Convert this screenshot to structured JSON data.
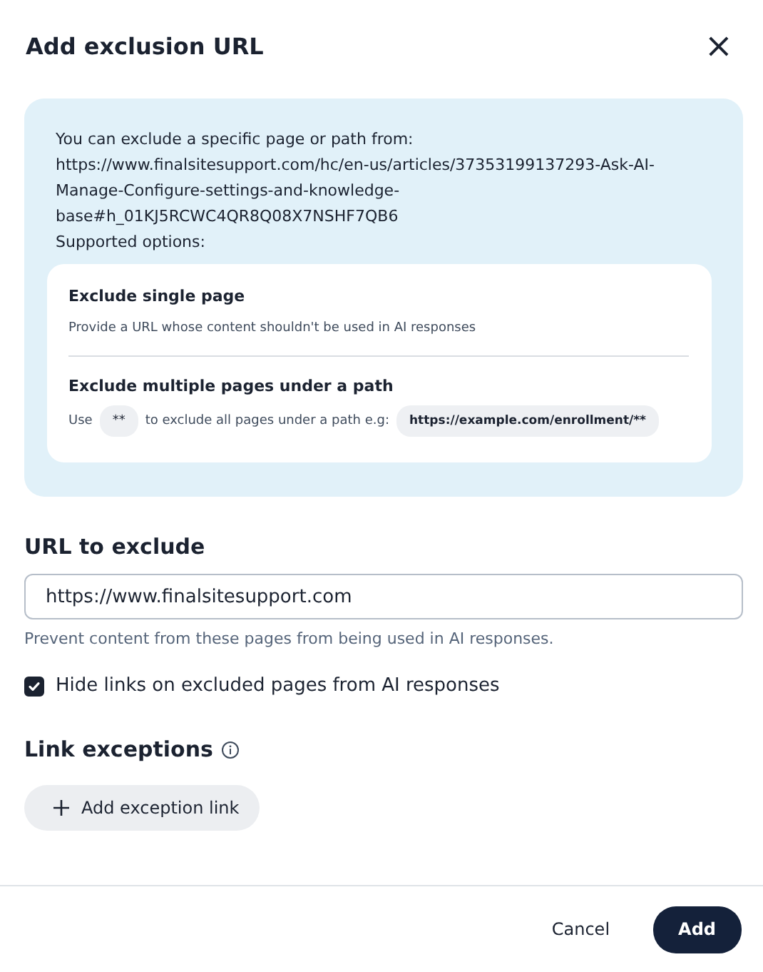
{
  "dialog": {
    "title": "Add exclusion URL",
    "close": "×"
  },
  "info": {
    "intro": "You can exclude a specific page or path from:",
    "url": "https://www.finalsitesupport.com/hc/en-us/articles/37353199137293-Ask-AI-Manage-Configure-settings-and-knowledge-base#h_01KJ5RCWC4QR8Q08X7NSHF7QB6",
    "options_label": "Supported options:",
    "options": [
      {
        "kind": "plain",
        "title": "Exclude single page",
        "description": "Provide a URL whose content shouldn't be used in AI responses"
      },
      {
        "kind": "pattern",
        "title": "Exclude multiple pages under a path",
        "prefix": "Use",
        "token": "**",
        "middle": "to exclude all pages under a path e.g:",
        "example": "https://example.com/enrollment/**"
      }
    ]
  },
  "url_field": {
    "label": "URL to exclude",
    "value": "https://www.finalsitesupport.com",
    "help": "Prevent content from these pages from being used in AI responses."
  },
  "hide_links": {
    "label": "Hide links on excluded pages from AI responses",
    "checked": true
  },
  "link_exceptions": {
    "title": "Link exceptions",
    "add_button": "Add exception link"
  },
  "footer": {
    "cancel": "Cancel",
    "confirm": "Add"
  }
}
